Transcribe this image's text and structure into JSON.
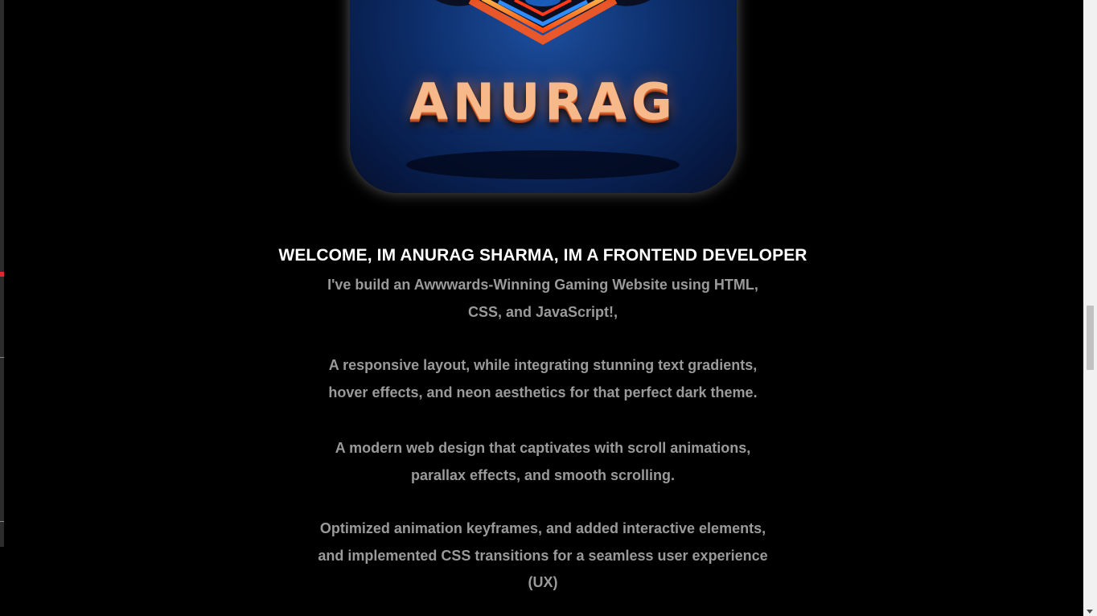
{
  "logo": {
    "text": "ANURAG"
  },
  "headline": "WELCOME, IM ANURAG SHARMA, IM A FRONTEND DEVELOPER",
  "paragraphs": [
    {
      "lines": [
        "I've build an Awwwards-Winning Gaming Website using HTML,",
        "CSS, and JavaScript!,"
      ]
    },
    {
      "lines": [
        "A responsive layout, while integrating stunning text gradients,",
        "hover effects, and neon aesthetics for that perfect dark theme."
      ]
    },
    {
      "lines": [
        "A modern web design that captivates with scroll animations,",
        "parallax effects, and smooth scrolling."
      ]
    },
    {
      "lines": [
        "Optimized animation keyframes, and added interactive elements,",
        "and implemented CSS transitions for a seamless user experience",
        "(UX)"
      ]
    }
  ],
  "colors": {
    "background": "#000000",
    "headline": "#ffffff",
    "body_text": "#9a9a9a",
    "accent": "#e3262e"
  }
}
